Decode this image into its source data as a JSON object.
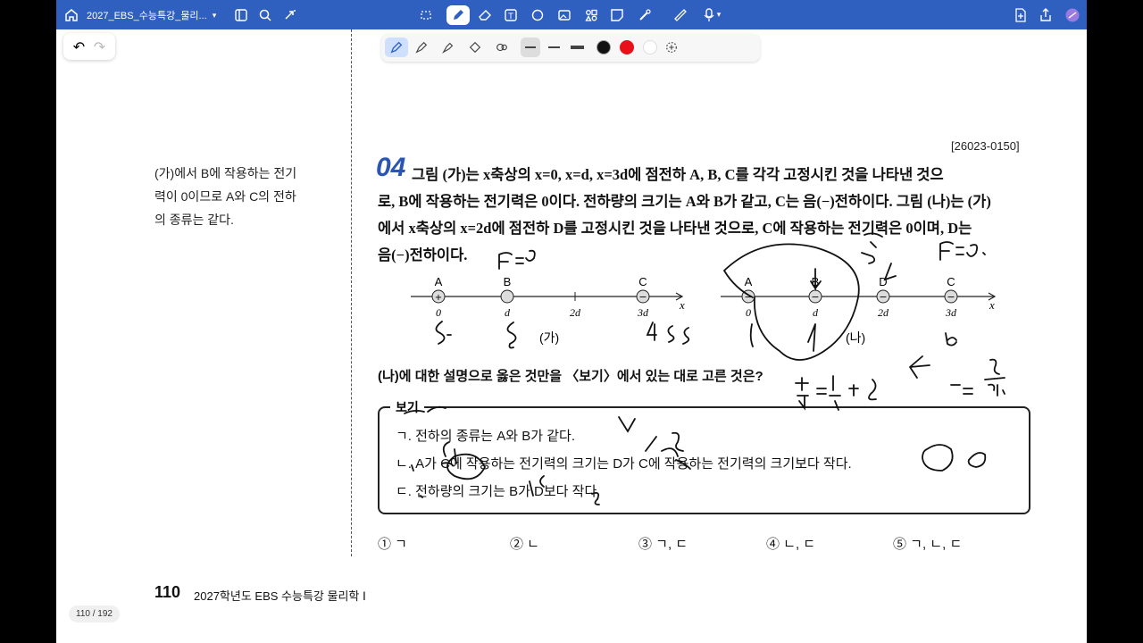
{
  "app": {
    "doc_title": "2027_EBS_수능특강_물리...",
    "page_indicator": "110 / 192"
  },
  "toolbar_icons": [
    "home-icon",
    "sidebar-icon",
    "search-icon",
    "share-icon",
    "lasso-icon",
    "pen-icon",
    "eraser-icon",
    "text-box-icon",
    "shape-icon",
    "image-icon",
    "elements-icon",
    "sticky-note-icon",
    "laser-pointer-icon",
    "ruler-icon",
    "microphone-icon",
    "add-page-icon",
    "export-icon",
    "profile-icon"
  ],
  "pen_toolbar": {
    "colors": [
      "#111111",
      "#e8111b",
      "#ffffff"
    ]
  },
  "sidebar_note": [
    "(가)에서 B에 작용하는 전기",
    "력이 0이므로 A와 C의 전하",
    "의 종류는 같다."
  ],
  "problem": {
    "id": "[26023-0150]",
    "number": "04",
    "lines": [
      "그림 (가)는 x축상의 x=0, x=d, x=3d에 점전하 A, B, C를 각각 고정시킨 것을 나타낸 것으",
      "로, B에 작용하는 전기력은 0이다. 전하량의 크기는 A와 B가 같고, C는 음(−)전하이다. 그림 (나)는 (가)",
      "에서 x축상의 x=2d에 점전하 D를 고정시킨 것을 나타낸 것으로, C에 작용하는 전기력은 0이며, D는",
      "음(−)전하이다."
    ],
    "question": "(나)에 대한 설명으로 옳은 것만을 〈보기〉에서 있는 대로 고른 것은?",
    "bogi_title": "보기",
    "bogi": [
      "ㄱ. 전하의 종류는 A와 B가 같다.",
      "ㄴ. A가 C에 작용하는 전기력의 크기는 D가 C에 작용하는 전기력의 크기보다 작다.",
      "ㄷ. 전하량의 크기는 B가 D보다 작다."
    ],
    "choices": [
      "① ㄱ",
      "② ㄴ",
      "③ ㄱ, ㄷ",
      "④ ㄴ, ㄷ",
      "⑤ ㄱ, ㄴ, ㄷ"
    ]
  },
  "figure_ga": {
    "label": "(가)",
    "axis": "x",
    "charges": [
      {
        "name": "A",
        "pos": "0",
        "sign": "+"
      },
      {
        "name": "B",
        "pos": "d",
        "sign": ""
      },
      {
        "name": "C",
        "pos": "3d",
        "sign": "−"
      }
    ],
    "tick": "2d"
  },
  "figure_na": {
    "label": "(나)",
    "axis": "x",
    "charges": [
      {
        "name": "A",
        "pos": "0",
        "sign": "−"
      },
      {
        "name": "B",
        "pos": "d",
        "sign": "−"
      },
      {
        "name": "D",
        "pos": "2d",
        "sign": "−"
      },
      {
        "name": "C",
        "pos": "3d",
        "sign": "−"
      }
    ]
  },
  "footer": {
    "page_number": "110",
    "title": "2027학년도 EBS 수능특강 물리학 Ⅰ"
  }
}
